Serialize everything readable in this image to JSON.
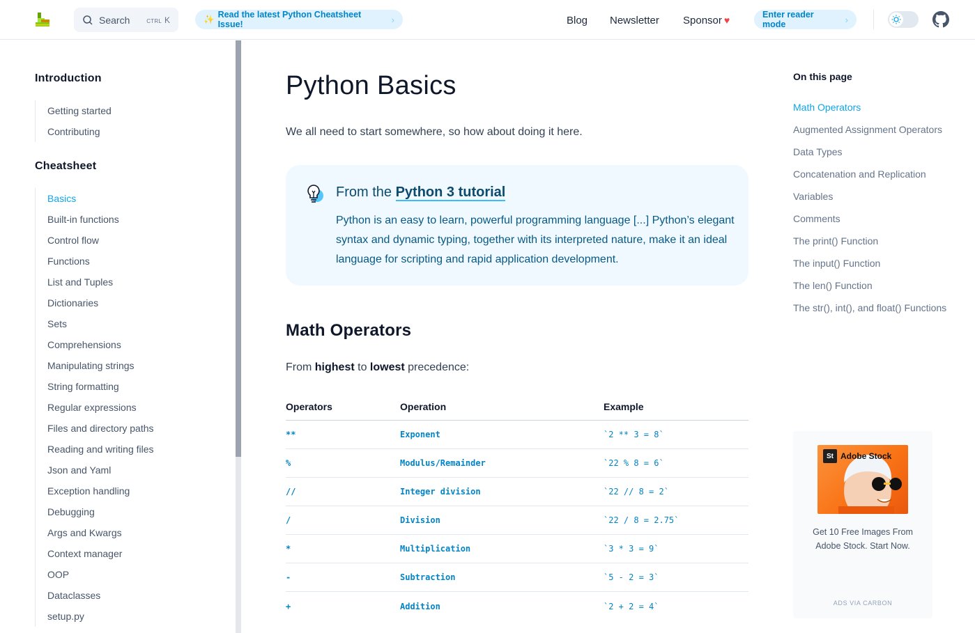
{
  "header": {
    "search": {
      "label": "Search",
      "shortcut_mod": "CTRL",
      "shortcut_key": "K"
    },
    "announcement": {
      "emoji": "✨",
      "label": "Read the latest Python Cheatsheet Issue!"
    },
    "nav": {
      "blog": "Blog",
      "newsletter": "Newsletter",
      "sponsor": "Sponsor"
    },
    "reader_mode": "Enter reader mode",
    "icons": {
      "logo": "python-cheatsheet-logo",
      "theme": "sun-icon",
      "repo": "github-icon"
    }
  },
  "sidebar": {
    "sections": [
      {
        "title": "Introduction",
        "items": [
          "Getting started",
          "Contributing"
        ]
      },
      {
        "title": "Cheatsheet",
        "items": [
          "Basics",
          "Built-in functions",
          "Control flow",
          "Functions",
          "List and Tuples",
          "Dictionaries",
          "Sets",
          "Comprehensions",
          "Manipulating strings",
          "String formatting",
          "Regular expressions",
          "Files and directory paths",
          "Reading and writing files",
          "Json and Yaml",
          "Exception handling",
          "Debugging",
          "Args and Kwargs",
          "Context manager",
          "OOP",
          "Dataclasses",
          "setup.py"
        ]
      }
    ],
    "active_item": "Basics"
  },
  "main": {
    "title": "Python Basics",
    "lead": "We all need to start somewhere, so how about doing it here.",
    "callout": {
      "prefix": "From the ",
      "link": "Python 3 tutorial",
      "body": "Python is an easy to learn, powerful programming language [...] Python’s elegant syntax and dynamic typing, together with its interpreted nature, make it an ideal language for scripting and rapid application development."
    },
    "section_title": "Math Operators",
    "precedence": {
      "pre": "From ",
      "highest": "highest",
      "mid": " to ",
      "lowest": "lowest",
      "post": " precedence:"
    },
    "table": {
      "headers": [
        "Operators",
        "Operation",
        "Example"
      ],
      "rows": [
        [
          "**",
          "Exponent",
          "`2 ** 3 = 8`"
        ],
        [
          "%",
          "Modulus/Remainder",
          "`22 % 8 = 6`"
        ],
        [
          "//",
          "Integer division",
          "`22 // 8 = 2`"
        ],
        [
          "/",
          "Division",
          "`22 / 8 = 2.75`"
        ],
        [
          "*",
          "Multiplication",
          "`3 * 3 = 9`"
        ],
        [
          "-",
          "Subtraction",
          "`5 - 2 = 3`"
        ],
        [
          "+",
          "Addition",
          "`2 + 2 = 4`"
        ]
      ]
    }
  },
  "toc": {
    "title": "On this page",
    "items": [
      "Math Operators",
      "Augmented Assignment Operators",
      "Data Types",
      "Concatenation and Replication",
      "Variables",
      "Comments",
      "The print() Function",
      "The input() Function",
      "The len() Function",
      "The str(), int(), and float() Functions"
    ],
    "active_item": "Math Operators"
  },
  "ad": {
    "brand": "Adobe Stock",
    "brand_mark": "St",
    "text": "Get 10 Free Images From Adobe Stock. Start Now.",
    "via": "ADS VIA CARBON"
  },
  "colors": {
    "accent": "#0ea5e9",
    "callout_bg": "#f0f9ff",
    "pill_bg": "#e0f2fe",
    "heart": "#ef4444"
  }
}
